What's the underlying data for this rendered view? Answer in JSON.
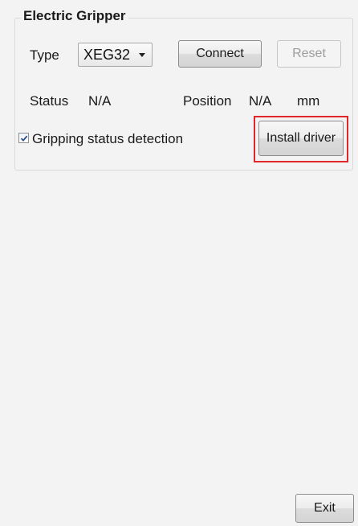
{
  "group": {
    "title": "Electric Gripper"
  },
  "type": {
    "label": "Type",
    "selected": "XEG32"
  },
  "buttons": {
    "connect": "Connect",
    "reset": "Reset",
    "install_driver": "Install driver",
    "exit": "Exit"
  },
  "status": {
    "label": "Status",
    "value": "N/A"
  },
  "position": {
    "label": "Position",
    "value": "N/A",
    "unit": "mm"
  },
  "detection": {
    "label": "Gripping status detection",
    "checked": true
  },
  "colors": {
    "highlight": "#e0262b",
    "check": "#2a4d8a"
  },
  "icons": {
    "combo_arrow": "chevron-down-icon",
    "checkmark": "checkmark-icon"
  }
}
